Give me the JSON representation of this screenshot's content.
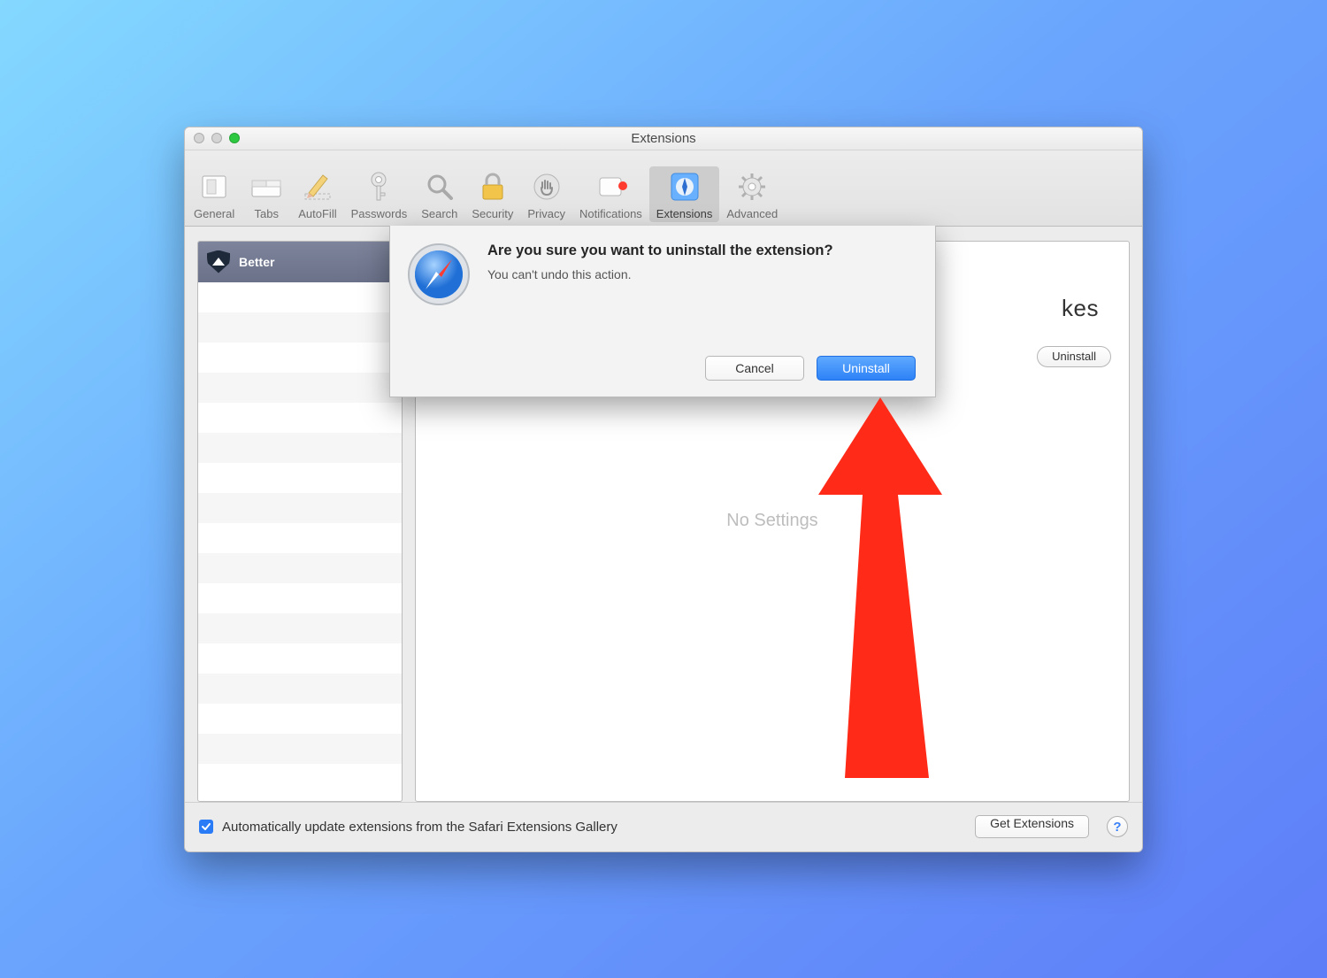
{
  "window": {
    "title": "Extensions"
  },
  "toolbar": {
    "items": [
      {
        "label": "General"
      },
      {
        "label": "Tabs"
      },
      {
        "label": "AutoFill"
      },
      {
        "label": "Passwords"
      },
      {
        "label": "Search"
      },
      {
        "label": "Security"
      },
      {
        "label": "Privacy"
      },
      {
        "label": "Notifications"
      },
      {
        "label": "Extensions"
      },
      {
        "label": "Advanced"
      }
    ]
  },
  "sidebar": {
    "selected_extension": "Better"
  },
  "detail": {
    "title_fragment": "kes",
    "uninstall_label": "Uninstall",
    "empty_text": "No Settings"
  },
  "dialog": {
    "title": "Are you sure you want to uninstall the extension?",
    "subtitle": "You can't undo this action.",
    "cancel_label": "Cancel",
    "confirm_label": "Uninstall"
  },
  "footer": {
    "checkbox_label": "Automatically update extensions from the Safari Extensions Gallery",
    "checkbox_checked": true,
    "get_extensions_label": "Get Extensions",
    "help_label": "?"
  }
}
